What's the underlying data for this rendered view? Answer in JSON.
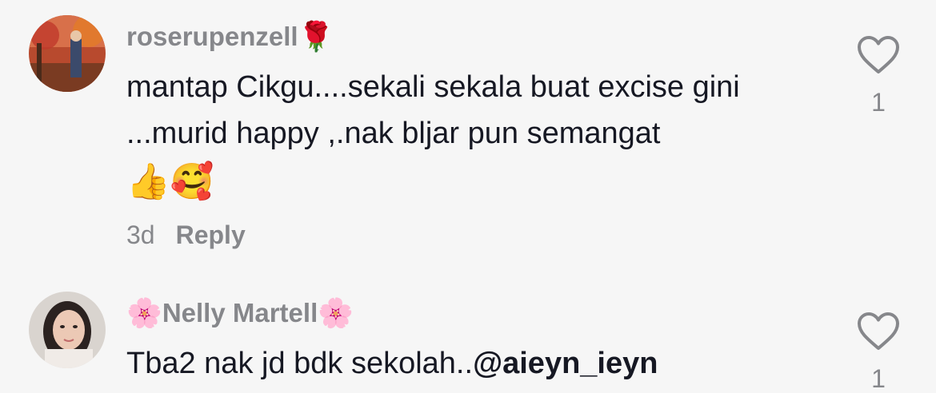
{
  "comments": [
    {
      "username": "roserupenzell",
      "username_suffix_emoji": "🌹",
      "text": "mantap Cikgu....sekali sekala buat excise gini ...murid happy ,.nak bljar pun semangat",
      "emojis": "👍🥰",
      "time": "3d",
      "reply_label": "Reply",
      "like_count": "1"
    },
    {
      "username_prefix_emoji": "🌸",
      "username": "Nelly Martell",
      "username_suffix_emoji": "🌸",
      "text": "Tba2 nak jd bdk sekolah..",
      "mention": "@aieyn_ieyn",
      "like_count": "1"
    }
  ],
  "icons": {
    "like": "heart-outline-icon"
  },
  "colors": {
    "background": "#f6f6f6",
    "text": "#161823",
    "muted": "#86878b"
  }
}
